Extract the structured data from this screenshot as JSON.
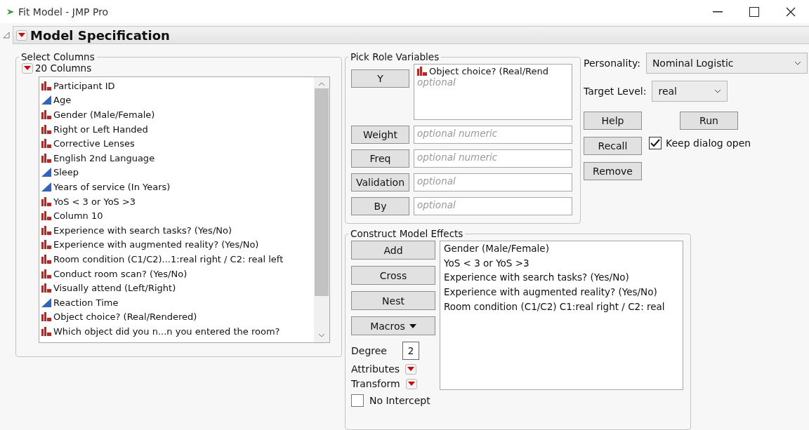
{
  "window": {
    "title": "Fit Model - JMP Pro"
  },
  "outline": {
    "title": "Model Specification"
  },
  "select_columns": {
    "title": "Select Columns",
    "count_label": "20 Columns",
    "columns": [
      {
        "name": "Participant ID",
        "kind": "nominal"
      },
      {
        "name": "Age",
        "kind": "continuous"
      },
      {
        "name": "Gender (Male/Female)",
        "kind": "nominal"
      },
      {
        "name": "Right or Left Handed",
        "kind": "nominal"
      },
      {
        "name": "Corrective Lenses",
        "kind": "nominal"
      },
      {
        "name": "English 2nd Language",
        "kind": "nominal"
      },
      {
        "name": "Sleep",
        "kind": "continuous"
      },
      {
        "name": "Years of service (In Years)",
        "kind": "continuous"
      },
      {
        "name": "YoS < 3 or YoS >3",
        "kind": "nominal"
      },
      {
        "name": "Column 10",
        "kind": "nominal"
      },
      {
        "name": "Experience with search tasks? (Yes/No)",
        "kind": "nominal"
      },
      {
        "name": "Experience with augmented reality? (Yes/No)",
        "kind": "nominal"
      },
      {
        "name": "Room condition (C1/C2)...1:real right / C2: real left",
        "kind": "nominal"
      },
      {
        "name": "Conduct room scan? (Yes/No)",
        "kind": "nominal"
      },
      {
        "name": "Visually attend (Left/Right)",
        "kind": "nominal"
      },
      {
        "name": "Reaction Time",
        "kind": "continuous"
      },
      {
        "name": "Object choice? (Real/Rendered)",
        "kind": "nominal"
      },
      {
        "name": "Which object did you n...n you entered the room?",
        "kind": "nominal"
      }
    ]
  },
  "pick_role_variables": {
    "title": "Pick Role Variables",
    "roles": [
      {
        "button": "Y",
        "value": {
          "name": "Object choice? (Real/Rend",
          "kind": "nominal"
        },
        "placeholder": "optional",
        "kind": "tall"
      },
      {
        "button": "Weight",
        "placeholder": "optional numeric",
        "kind": "single"
      },
      {
        "button": "Freq",
        "placeholder": "optional numeric",
        "kind": "single"
      },
      {
        "button": "Validation",
        "placeholder": "optional",
        "kind": "single"
      },
      {
        "button": "By",
        "placeholder": "optional",
        "kind": "single"
      }
    ]
  },
  "personality": {
    "label": "Personality:",
    "value": "Nominal Logistic"
  },
  "target_level": {
    "label": "Target Level:",
    "value": "real"
  },
  "action_buttons": [
    [
      "Help",
      "Run"
    ],
    [
      "Recall"
    ],
    [
      "Remove"
    ]
  ],
  "keep_dialog_open": {
    "label": "Keep dialog open",
    "checked": true
  },
  "construct_model_effects": {
    "title": "Construct Model Effects",
    "buttons": [
      {
        "label": "Add",
        "kind": "plain"
      },
      {
        "label": "Cross",
        "kind": "plain"
      },
      {
        "label": "Nest",
        "kind": "plain"
      },
      {
        "label": "Macros",
        "kind": "menu"
      }
    ],
    "degree": {
      "label": "Degree",
      "value": "2"
    },
    "attributes": {
      "label": "Attributes"
    },
    "transform": {
      "label": "Transform"
    },
    "no_intercept": {
      "label": "No Intercept",
      "checked": false
    },
    "effects": [
      "Gender (Male/Female)",
      "YoS < 3 or YoS >3",
      "Experience with search tasks? (Yes/No)",
      "Experience with augmented reality? (Yes/No)",
      "Room condition (C1/C2) C1:real right / C2: real"
    ]
  }
}
